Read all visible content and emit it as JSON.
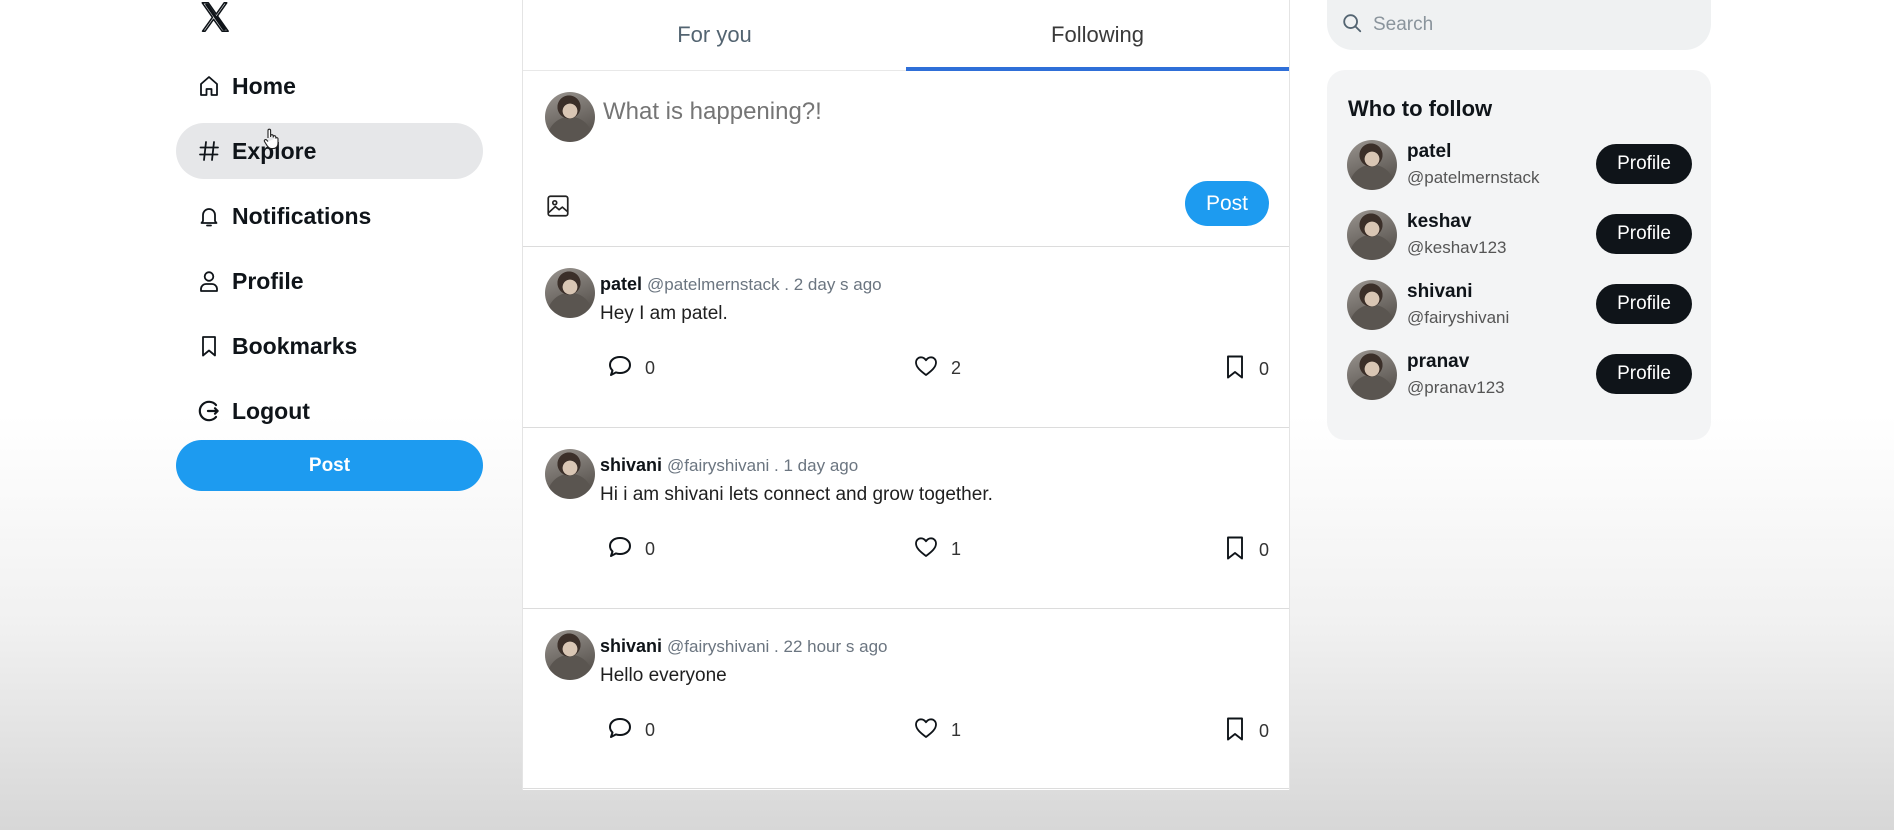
{
  "sidebar": {
    "logo_icon": "x-logo-icon",
    "items": [
      {
        "label": "Home",
        "icon": "home-icon"
      },
      {
        "label": "Explore",
        "icon": "hashtag-icon"
      },
      {
        "label": "Notifications",
        "icon": "bell-icon"
      },
      {
        "label": "Profile",
        "icon": "user-icon"
      },
      {
        "label": "Bookmarks",
        "icon": "bookmark-icon"
      },
      {
        "label": "Logout",
        "icon": "logout-icon"
      }
    ],
    "active_item": "Explore",
    "post_label": "Post"
  },
  "feed": {
    "tabs": [
      {
        "label": "For you"
      },
      {
        "label": "Following"
      }
    ],
    "active_tab": "Following",
    "composer": {
      "placeholder": "What is happening?!",
      "post_label": "Post",
      "media_icon": "image-icon"
    },
    "tweets": [
      {
        "name": "patel",
        "meta": "@patelmernstack . 2 day s ago",
        "text": "Hey I am patel.",
        "replies": "0",
        "likes": "2",
        "bookmarks": "0"
      },
      {
        "name": "shivani",
        "meta": "@fairyshivani . 1 day ago",
        "text": "Hi i am shivani lets connect and grow together.",
        "replies": "0",
        "likes": "1",
        "bookmarks": "0"
      },
      {
        "name": "shivani",
        "meta": "@fairyshivani . 22 hour s ago",
        "text": "Hello everyone",
        "replies": "0",
        "likes": "1",
        "bookmarks": "0"
      }
    ]
  },
  "search": {
    "placeholder": "Search",
    "icon": "search-icon"
  },
  "who_to_follow": {
    "title": "Who to follow",
    "users": [
      {
        "name": "patel",
        "handle": "@patelmernstack",
        "button": "Profile"
      },
      {
        "name": "keshav",
        "handle": "@keshav123",
        "button": "Profile"
      },
      {
        "name": "shivani",
        "handle": "@fairyshivani",
        "button": "Profile"
      },
      {
        "name": "pranav",
        "handle": "@pranav123",
        "button": "Profile"
      }
    ]
  },
  "colors": {
    "accent": "#1d9bf0",
    "tab_indicator": "#2f6fd8",
    "dark_button": "#0f1419"
  }
}
